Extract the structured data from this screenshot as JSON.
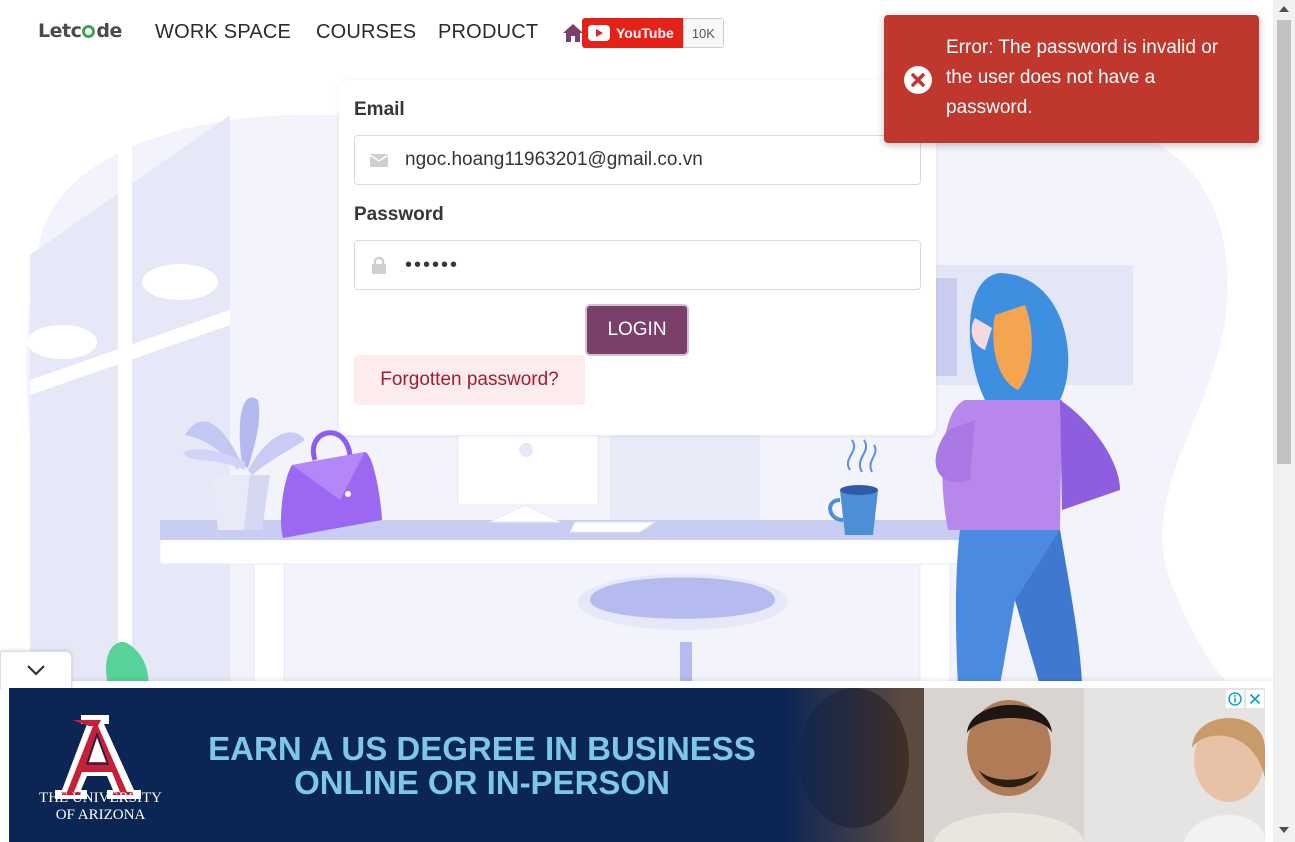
{
  "navbar": {
    "logo": {
      "prefix": "Letc",
      "suffix": "de"
    },
    "links": [
      "WORK SPACE",
      "COURSES",
      "PRODUCT"
    ],
    "youtube": {
      "label": "YouTube",
      "count": "10K"
    }
  },
  "login": {
    "email_label": "Email",
    "email_value": "ngoc.hoang11963201@gmail.co.vn",
    "password_label": "Password",
    "password_value": "••••••",
    "login_button": "LOGIN",
    "forgot_link": "Forgotten password?"
  },
  "toast": {
    "message": "Error: The password is invalid or the user does not have a password.",
    "icon": "error-circle-icon"
  },
  "ad": {
    "university": "THE UNIVERSITY OF ARIZONA",
    "headline": "EARN A US DEGREE IN BUSINESS ONLINE OR IN-PERSON",
    "icons": [
      "info-icon",
      "close-icon",
      "chevron-down-icon"
    ]
  },
  "colors": {
    "brand_purple": "#7a4069",
    "toast_red": "#c0372d",
    "forgot_bg": "#fdecee",
    "ad_navy": "#0b2554",
    "ad_text": "#7cc8e8"
  }
}
